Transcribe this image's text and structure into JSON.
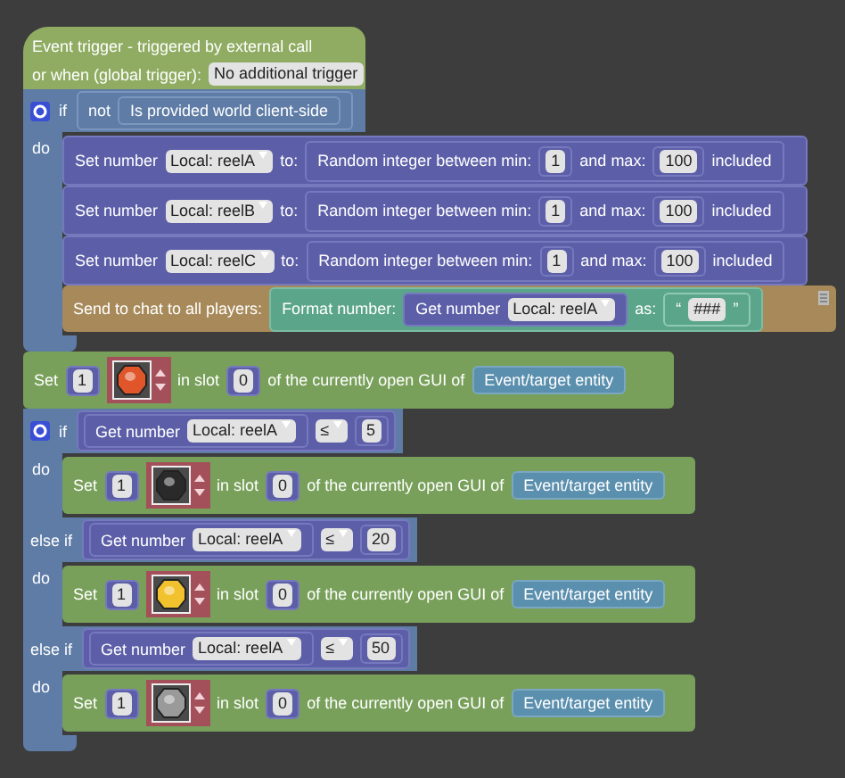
{
  "event": {
    "title": "Event trigger - triggered by external call",
    "trigger_label": "or when (global trigger):",
    "trigger_value": "No additional trigger"
  },
  "statements": [
    {
      "kind": "if",
      "branches": [
        {
          "keyword": "if",
          "condition": {
            "kind": "not",
            "label": "not",
            "operand": "Is provided world client-side"
          },
          "do_label": "do",
          "body": [
            {
              "kind": "set_number",
              "label": "Set number",
              "variable": "Local: reelA",
              "to_label": "to:",
              "value": {
                "label": "Random integer between min:",
                "min": "1",
                "max_label": "and max:",
                "max": "100",
                "suffix": "included"
              }
            },
            {
              "kind": "set_number",
              "label": "Set number",
              "variable": "Local: reelB",
              "to_label": "to:",
              "value": {
                "label": "Random integer between min:",
                "min": "1",
                "max_label": "and max:",
                "max": "100",
                "suffix": "included"
              }
            },
            {
              "kind": "set_number",
              "label": "Set number",
              "variable": "Local: reelC",
              "to_label": "to:",
              "value": {
                "label": "Random integer between min:",
                "min": "1",
                "max_label": "and max:",
                "max": "100",
                "suffix": "included"
              }
            },
            {
              "kind": "chat",
              "label": "Send to chat to all players:",
              "format": {
                "label": "Format number:",
                "getter": {
                  "label": "Get number",
                  "variable": "Local: reelA"
                },
                "as_label": "as:",
                "open_quote": "“",
                "pattern": "###",
                "close_quote": "”"
              }
            }
          ]
        }
      ]
    },
    {
      "kind": "set_slot",
      "label": "Set",
      "count": "1",
      "item": {
        "color": "#e0562a"
      },
      "slot_label": "in slot",
      "slot": "0",
      "of_label": "of the currently open GUI of",
      "target": "Event/target entity"
    },
    {
      "kind": "if",
      "branches": [
        {
          "keyword": "if",
          "condition": {
            "kind": "compare",
            "getter": {
              "label": "Get number",
              "variable": "Local: reelA"
            },
            "operator": "≤",
            "operand": "5"
          },
          "do_label": "do",
          "body": [
            {
              "kind": "set_slot",
              "label": "Set",
              "count": "1",
              "item": {
                "color": "#2a2a2a"
              },
              "slot_label": "in slot",
              "slot": "0",
              "of_label": "of the currently open GUI of",
              "target": "Event/target entity"
            }
          ]
        },
        {
          "keyword": "else if",
          "condition": {
            "kind": "compare",
            "getter": {
              "label": "Get number",
              "variable": "Local: reelA"
            },
            "operator": "≤",
            "operand": "20"
          },
          "do_label": "do",
          "body": [
            {
              "kind": "set_slot",
              "label": "Set",
              "count": "1",
              "item": {
                "color": "#f2c12e"
              },
              "slot_label": "in slot",
              "slot": "0",
              "of_label": "of the currently open GUI of",
              "target": "Event/target entity"
            }
          ]
        },
        {
          "keyword": "else if",
          "condition": {
            "kind": "compare",
            "getter": {
              "label": "Get number",
              "variable": "Local: reelA"
            },
            "operator": "≤",
            "operand": "50"
          },
          "do_label": "do",
          "body": [
            {
              "kind": "set_slot",
              "label": "Set",
              "count": "1",
              "item": {
                "color": "#9a9a9a"
              },
              "slot_label": "in slot",
              "slot": "0",
              "of_label": "of the currently open GUI of",
              "target": "Event/target entity"
            }
          ]
        }
      ]
    }
  ]
}
